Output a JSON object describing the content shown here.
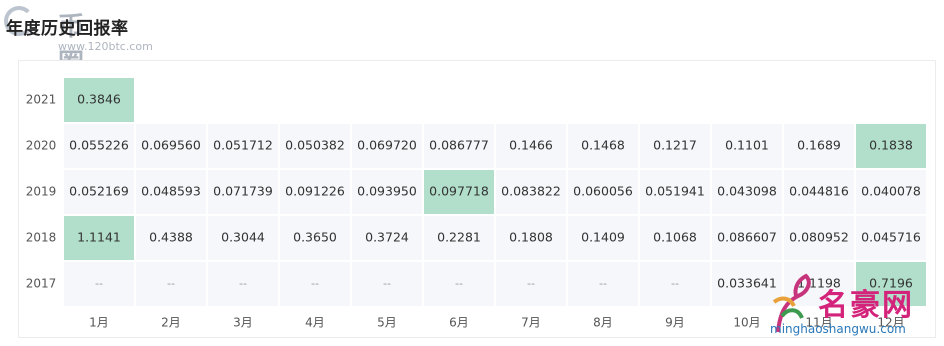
{
  "header": {
    "title": "年度历史回报率",
    "logo_name": "币圈子",
    "logo_url": "www.120btc.com"
  },
  "watermark": {
    "brand": "名豪网",
    "domain": "minghaoshangwu.com"
  },
  "colors": {
    "highlight": "#b2dfcc",
    "cell": "#f6f7fa",
    "text": "#333333",
    "axis_text": "#555555",
    "empty_text": "#999999"
  },
  "chart_data": {
    "type": "heatmap",
    "title": "年度历史回报率",
    "columns": [
      "1月",
      "2月",
      "3月",
      "4月",
      "5月",
      "6月",
      "7月",
      "8月",
      "9月",
      "10月",
      "11月",
      "12月"
    ],
    "rows": [
      "2021",
      "2020",
      "2019",
      "2018",
      "2017"
    ],
    "values": [
      [
        "0.3846",
        null,
        null,
        null,
        null,
        null,
        null,
        null,
        null,
        null,
        null,
        null
      ],
      [
        "0.055226",
        "0.069560",
        "0.051712",
        "0.050382",
        "0.069720",
        "0.086777",
        "0.1466",
        "0.1468",
        "0.1217",
        "0.1101",
        "0.1689",
        "0.1838"
      ],
      [
        "0.052169",
        "0.048593",
        "0.071739",
        "0.091226",
        "0.093950",
        "0.097718",
        "0.083822",
        "0.060056",
        "0.051941",
        "0.043098",
        "0.044816",
        "0.040078"
      ],
      [
        "1.1141",
        "0.4388",
        "0.3044",
        "0.3650",
        "0.3724",
        "0.2281",
        "0.1808",
        "0.1409",
        "0.1068",
        "0.086607",
        "0.080952",
        "0.045716"
      ],
      [
        "--",
        "--",
        "--",
        "--",
        "--",
        "--",
        "--",
        "--",
        "--",
        "0.033641",
        "1.1198",
        "0.7196"
      ]
    ],
    "highlighted_cells": [
      [
        0,
        0
      ],
      [
        1,
        11
      ],
      [
        2,
        5
      ],
      [
        3,
        0
      ],
      [
        4,
        11
      ]
    ],
    "legend": "none"
  }
}
